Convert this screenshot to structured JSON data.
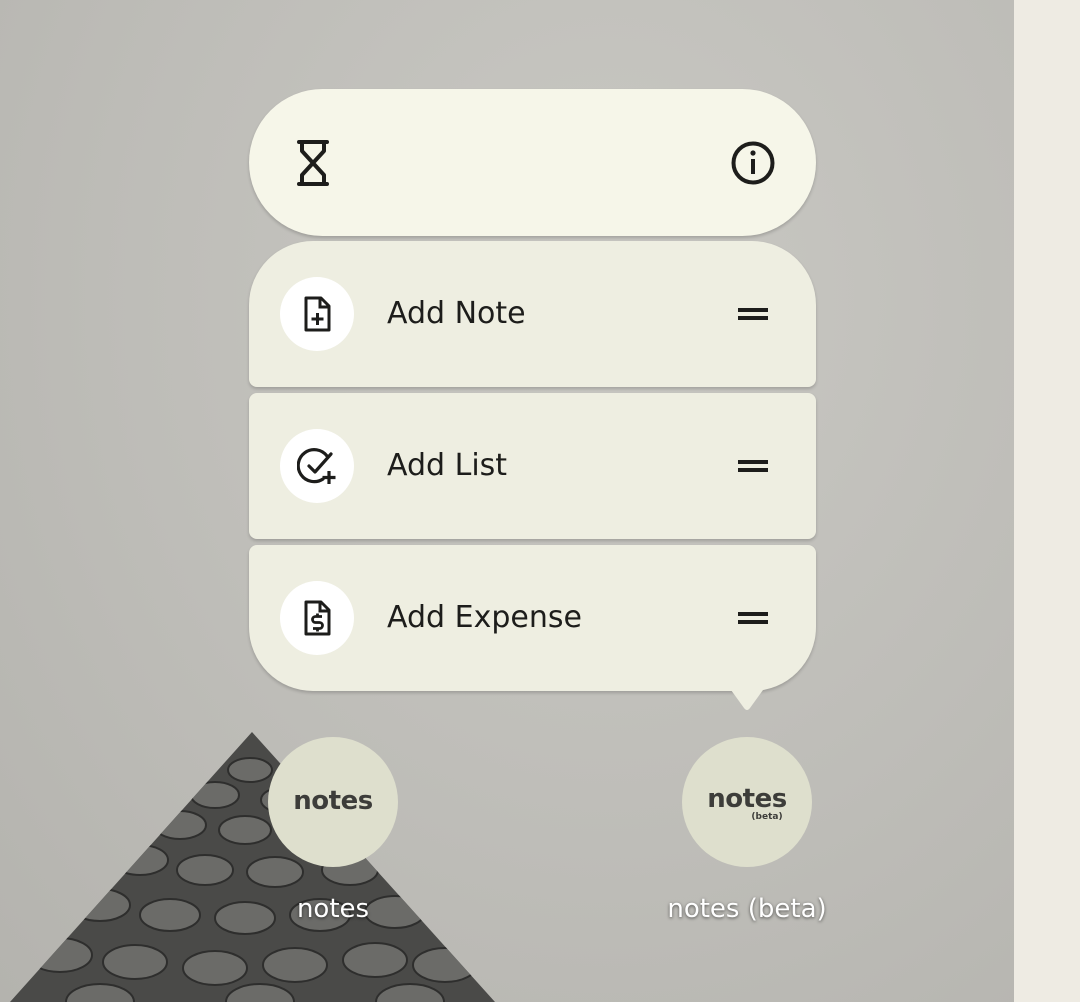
{
  "popup": {
    "header_icons": [
      "hourglass-icon",
      "info-icon"
    ],
    "shortcuts": [
      {
        "label": "Add Note",
        "icon": "note-add-icon"
      },
      {
        "label": "Add List",
        "icon": "add-task-icon"
      },
      {
        "label": "Add Expense",
        "icon": "expense-icon"
      }
    ]
  },
  "apps": [
    {
      "icon_text": "notes",
      "label": "notes"
    },
    {
      "icon_text": "notes",
      "icon_subtext": "(beta)",
      "label": "notes (beta)"
    }
  ],
  "colors": {
    "menu_header": "#f6f6e9",
    "menu_item": "#eeeee1",
    "app_icon_bg": "#dedfcd"
  }
}
